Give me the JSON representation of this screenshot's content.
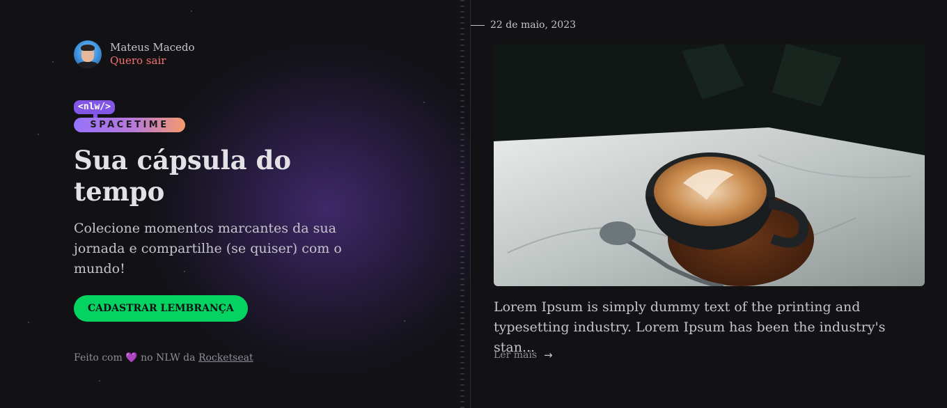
{
  "user": {
    "name": "Mateus Macedo",
    "logout_label": "Quero sair"
  },
  "logo": {
    "tag": "<nlw/>",
    "word": "SPACETIME"
  },
  "hero": {
    "title": "Sua cápsula do tempo",
    "subtitle": "Colecione momentos marcantes da sua jornada e compartilhe (se quiser) com o mundo!",
    "cta_label": "CADASTRAR LEMBRANÇA"
  },
  "footer": {
    "prefix": "Feito com",
    "heart": "💜",
    "middle": "no NLW da",
    "link": "Rocketseat"
  },
  "memory": {
    "date": "22 de maio, 2023",
    "excerpt": "Lorem Ipsum is simply dummy text of the printing and typesetting industry. Lorem Ipsum has been the industry's stan...",
    "read_more_label": "Ler mais",
    "read_more_icon": "arrow-right-icon"
  },
  "colors": {
    "accent_green": "#04d361",
    "accent_purple": "#8257e5",
    "logout_red": "#f87171",
    "background": "#121215"
  }
}
